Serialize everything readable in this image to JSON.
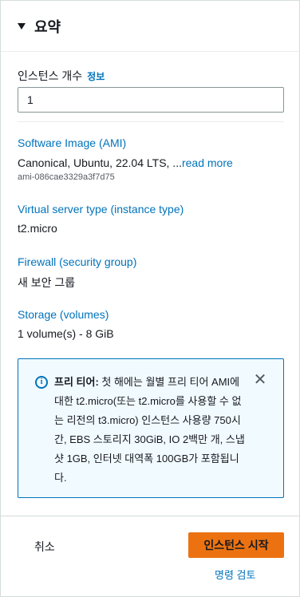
{
  "header": {
    "title": "요약"
  },
  "instance_count": {
    "label": "인스턴스 개수",
    "info": "정보",
    "value": "1"
  },
  "sections": {
    "ami": {
      "title": "Software Image (AMI)",
      "value": "Canonical, Ubuntu, 22.04 LTS, ...",
      "read_more": "read more",
      "id": "ami-086cae3329a3f7d75"
    },
    "instance_type": {
      "title": "Virtual server type (instance type)",
      "value": "t2.micro"
    },
    "firewall": {
      "title": "Firewall (security group)",
      "value": "새 보안 그룹"
    },
    "storage": {
      "title": "Storage (volumes)",
      "value": "1 volume(s) - 8 GiB"
    }
  },
  "free_tier_alert": {
    "icon": "info-icon",
    "bold": "프리 티어:",
    "text": " 첫 해에는 월별 프리 티어 AMI에 대한 t2.micro(또는 t2.micro를 사용할 수 없는 리전의 t3.micro) 인스턴스 사용량 750시간, EBS 스토리지 30GiB, IO 2백만 개, 스냅샷 1GB, 인터넷 대역폭 100GB가 포함됩니다.",
    "close_icon": "close-icon"
  },
  "footer": {
    "cancel_label": "취소",
    "launch_label": "인스턴스 시작",
    "review_label": "명령 검토"
  },
  "colors": {
    "link": "#0073bb",
    "primary_button": "#ec7211",
    "alert_bg": "#f1faff",
    "text": "#16191f"
  }
}
